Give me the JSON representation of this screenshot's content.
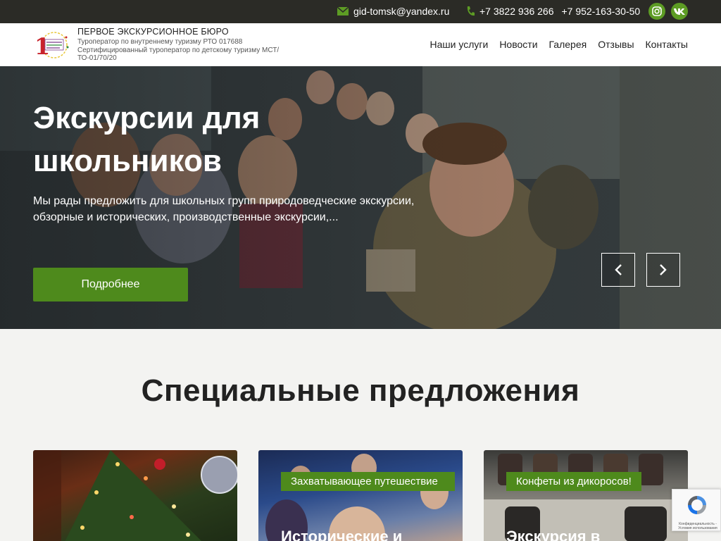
{
  "topbar": {
    "email": "gid-tomsk@yandex.ru",
    "phone1": "+7 3822 936 266",
    "phone2": "+7 952-163-30-50",
    "social": [
      "instagram-icon",
      "vk-icon"
    ]
  },
  "header": {
    "brand_title": "ПЕРВОЕ ЭКСКУРСИОННОЕ БЮРО",
    "brand_sub1": "Туроператор по внутреннему туризму РТО 017688",
    "brand_sub2": "Сертифицированный туроператор по детскому туризму МСТ/ ТО-01/70/20",
    "logo_number": "1",
    "nav": [
      "Наши услуги",
      "Новости",
      "Галерея",
      "Отзывы",
      "Контакты"
    ]
  },
  "hero": {
    "title": "Экскурсии для школьников",
    "text": "Мы рады предложить для школьных групп природоведческие экскурсии, обзорные и исторических, производственные экскурсии,...",
    "button": "Подробнее"
  },
  "offers": {
    "title": "Специальные предложения",
    "cards": [
      {
        "tag": "",
        "title": ""
      },
      {
        "tag": "Захватывающее путешествие",
        "title": "Исторические и"
      },
      {
        "tag": "Конфеты из дикоросов!",
        "title": "Экскурсия в"
      }
    ]
  },
  "recaptcha": {
    "text": "Конфиденциальность - Условия использования"
  },
  "colors": {
    "accent": "#4e8a1c",
    "topbar": "#2b2b26",
    "social": "#5d9c24"
  }
}
